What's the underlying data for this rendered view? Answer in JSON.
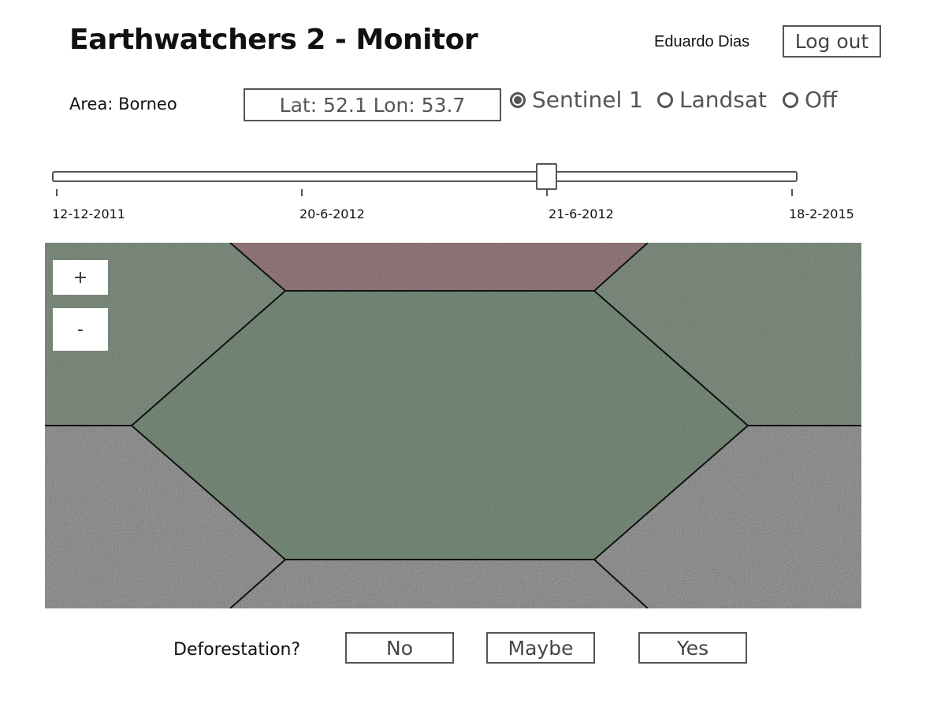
{
  "header": {
    "title": "Earthwatchers 2 - Monitor",
    "user_name": "Eduardo Dias",
    "logout_label": "Log out"
  },
  "location": {
    "area_label": "Area: Borneo",
    "coordinates": "Lat: 52.1 Lon: 53.7"
  },
  "imagery": {
    "options": [
      {
        "label": "Sentinel 1",
        "selected": true
      },
      {
        "label": "Landsat",
        "selected": false
      },
      {
        "label": "Off",
        "selected": false
      }
    ]
  },
  "timeline": {
    "ticks": [
      "12-12-2011",
      "20-6-2012",
      "21-6-2012",
      "18-2-2015"
    ],
    "selected_date": "21-6-2012"
  },
  "map": {
    "zoom_in_label": "+",
    "zoom_out_label": "-",
    "colors": {
      "selected_hex_tint": "#5f7f61",
      "top_hex_tint": "#8a5a5e",
      "neighbor_tint": "#5f7a61",
      "grid_line": "#111111"
    }
  },
  "question": {
    "label": "Deforestation?",
    "answers": [
      "No",
      "Maybe",
      "Yes"
    ]
  }
}
